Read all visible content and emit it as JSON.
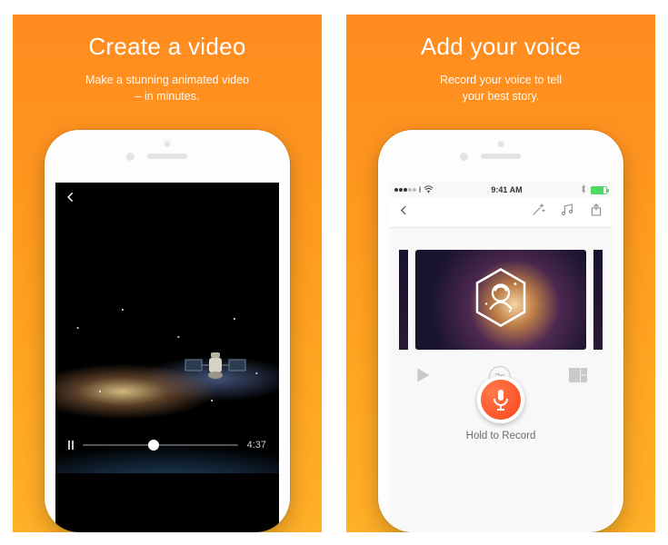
{
  "panels": [
    {
      "title": "Create a video",
      "subtitle_line1": "Make a stunning animated video",
      "subtitle_line2": "– in minutes.",
      "player": {
        "time": "4:37",
        "progress": 0.46
      }
    },
    {
      "title": "Add your voice",
      "subtitle_line1": "Record your voice to tell",
      "subtitle_line2": "your best story.",
      "statusbar": {
        "carrier": "ł",
        "time": "9:41 AM"
      },
      "duration_badge": "2s",
      "record_label": "Hold to Record"
    }
  ]
}
